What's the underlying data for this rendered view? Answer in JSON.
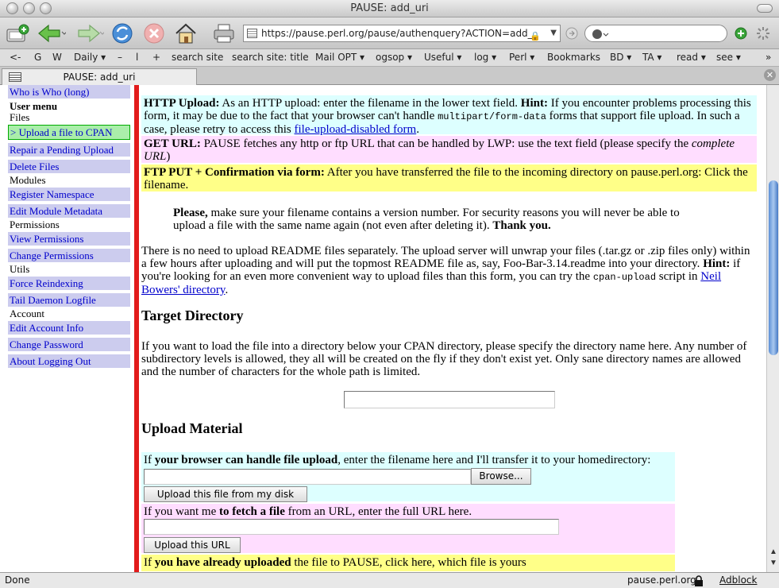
{
  "window": {
    "title": "PAUSE: add_uri"
  },
  "navbar": {
    "url": "https://pause.perl.org/pause/authenquery?ACTION=add_",
    "search_placeholder": ""
  },
  "bookmarks": [
    "<-",
    "G",
    "W",
    "Daily ▾",
    "–",
    "l",
    "+",
    "search site",
    "search site: title",
    "Mail OPT ▾",
    "ogsop ▾",
    "Useful ▾",
    "log ▾",
    "Perl ▾",
    "Bookmarks",
    "BD ▾",
    "TA ▾",
    "read ▾",
    "see ▾",
    "»"
  ],
  "tab": {
    "label": "PAUSE: add_uri"
  },
  "sidebar": {
    "who_is_who": "Who is Who (long)",
    "user_menu": "User menu",
    "files": "Files",
    "upload": "> Upload a file to CPAN",
    "repair": "Repair a Pending Upload",
    "delete": "Delete Files",
    "modules": "Modules",
    "register_ns": "Register Namespace",
    "edit_meta": "Edit Module Metadata",
    "permissions": "Permissions",
    "view_perm": "View Permissions",
    "change_perm": "Change Permissions",
    "utils": "Utils",
    "force_reindex": "Force Reindexing",
    "tail_daemon": "Tail Daemon Logfile",
    "account": "Account",
    "edit_account": "Edit Account Info",
    "change_pw": "Change Password",
    "logout": "About Logging Out"
  },
  "content": {
    "http_label": "HTTP Upload:",
    "http_text1": " As an HTTP upload: enter the filename in the lower text field. ",
    "hint": "Hint:",
    "http_text2": " If you encounter problems processing this form, it may be due to the fact that your browser can't handle ",
    "multipart": "multipart/form-data",
    "http_text3": " forms that support file upload. In such a case, please retry to access this ",
    "file_upload_disabled": "file-upload-disabled form",
    "period": ".",
    "get_label": "GET URL:",
    "get_text": " PAUSE fetches any http or ftp URL that can be handled by LWP: use the text field (please specify the ",
    "complete_url": "complete URL",
    "close_paren": ")",
    "ftp_label": "FTP PUT + Confirmation via form:",
    "ftp_text": " After you have transferred the file to the incoming directory on pause.perl.org: Click the filename.",
    "please": "Please,",
    "please_text": " make sure your filename contains a version number. For security reasons you will never be able to upload a file with the same name again (not even after deleting it). ",
    "thank_you": "Thank you.",
    "readme_text1": "There is no need to upload README files separately. The upload server will unwrap your files (.tar.gz or .zip files only) within a few hours after uploading and will put the topmost README file as, say, Foo-Bar-3.14.readme into your directory. ",
    "readme_hint": "Hint:",
    "readme_text2": " if you're looking for an even more convenient way to upload files than this form, you can try the ",
    "cpan_upload": "cpan-upload",
    "script_in": " script in ",
    "neil_link": "Neil Bowers' directory",
    "target_heading": "Target Directory",
    "target_text": "If you want to load the file into a directory below your CPAN directory, please specify the directory name here. Any number of subdirectory levels is allowed, they all will be created on the fly if they don't exist yet. Only sane directory names are allowed and the number of characters for the whole path is limited.",
    "upload_heading": "Upload Material",
    "if1": "If ",
    "browser_can": "your browser can handle file upload",
    "if1_rest": ", enter the filename here and I'll transfer it to your homedirectory:",
    "browse": "Browse...",
    "upload_disk": "Upload this file from my disk",
    "if2": "If you want me ",
    "fetch_file": "to fetch a file",
    "if2_rest": " from an URL, enter the full URL here.",
    "upload_url": "Upload this URL",
    "if3": "If ",
    "already_uploaded": "you have already uploaded",
    "if3_rest": " the file to PAUSE, click here, which file is yours"
  },
  "status": {
    "left": "Done",
    "host": "pause.perl.org",
    "adblock": "Adblock"
  }
}
